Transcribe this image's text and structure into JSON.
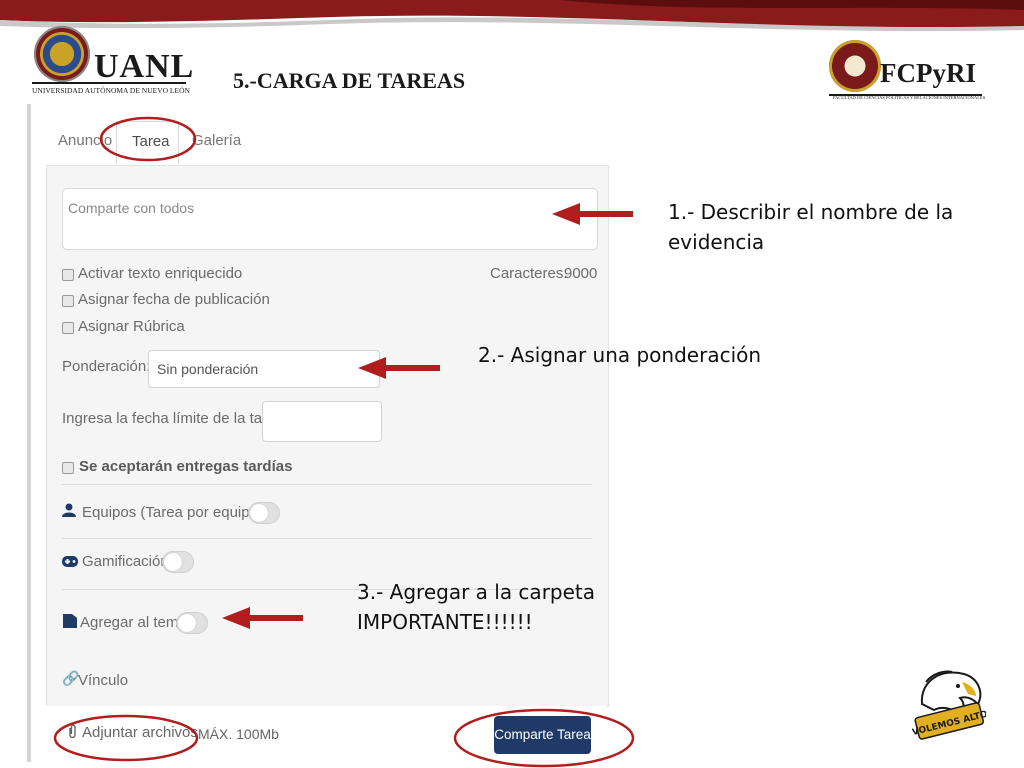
{
  "slide": {
    "title": "5.-CARGA DE TAREAS"
  },
  "logos": {
    "left_name": "UANL",
    "left_subtitle": "UNIVERSIDAD AUTÓNOMA DE NUEVO LEÓN",
    "right_name": "FCPyRI",
    "right_subtitle": "FACULTAD DE CIENCIAS POLÍTICAS Y RELACIONES INTERNACIONALES",
    "badge_text": "¡VOLEMOS ALTO!"
  },
  "tabs": [
    "Anuncio",
    "Tarea",
    "Galería"
  ],
  "form": {
    "share_placeholder": "Comparte con todos",
    "rich_text": "Activar texto enriquecido",
    "characters_label": "Caracteres:",
    "characters_value": "9000",
    "publish_date": "Asignar fecha de publicación",
    "rubric": "Asignar Rúbrica",
    "weight_label": "Ponderación:",
    "weight_value": "Sin ponderación",
    "deadline_label": "Ingresa la fecha límite de la tarea:",
    "late_label": "Se aceptarán entregas tardías",
    "teams_label": "Equipos (Tarea por equipos)",
    "gamification_label": "Gamificación",
    "topic_label": "Agregar al tema",
    "link_label": "Vínculo",
    "attach_label": "Adjuntar archivos",
    "max_size": "MÁX. 100Mb",
    "submit_label": "Comparte Tarea"
  },
  "annotations": {
    "step1_line1": "1.- Describir el nombre de la",
    "step1_line2": "evidencia",
    "step2": "2.- Asignar una ponderación",
    "step3_line1": "3.- Agregar a la carpeta",
    "step3_line2": "IMPORTANTE!!!!!!"
  },
  "colors": {
    "banner": "#8b1a1a",
    "arrow": "#b01e1e",
    "button": "#1f3a66"
  },
  "icons": [
    "user-icon",
    "gamepad-icon",
    "folder-icon",
    "link-icon",
    "paperclip-icon"
  ]
}
